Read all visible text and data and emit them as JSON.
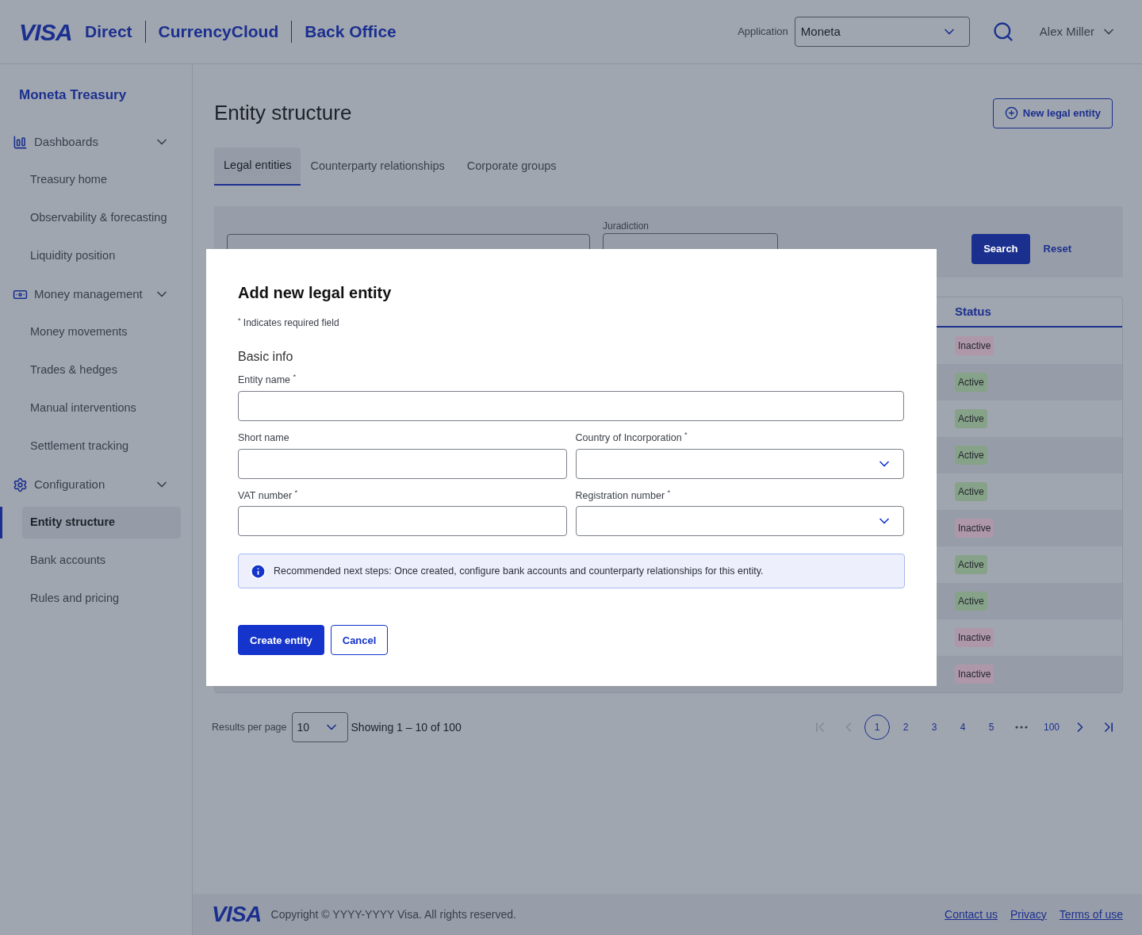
{
  "header": {
    "logo": "VISA",
    "products": [
      "Direct",
      "CurrencyCloud",
      "Back Office"
    ],
    "application": {
      "label": "Application",
      "value": "Moneta"
    },
    "user": "Alex Miller"
  },
  "sidebar": {
    "title": "Moneta Treasury",
    "groups": [
      {
        "label": "Dashboards",
        "expanded": true,
        "items": [
          {
            "label": "Treasury home",
            "selected": false
          },
          {
            "label": "Observability & forecasting",
            "selected": false
          },
          {
            "label": "Liquidity position",
            "selected": false
          }
        ]
      },
      {
        "label": "Money management",
        "expanded": true,
        "items": [
          {
            "label": "Money movements",
            "selected": false
          },
          {
            "label": "Trades & hedges",
            "selected": false
          },
          {
            "label": "Manual interventions",
            "selected": false
          },
          {
            "label": "Settlement tracking",
            "selected": false
          }
        ]
      },
      {
        "label": "Configuration",
        "expanded": true,
        "items": [
          {
            "label": "Entity structure",
            "selected": true
          },
          {
            "label": "Bank accounts",
            "selected": false
          },
          {
            "label": "Rules and pricing",
            "selected": false
          }
        ]
      }
    ]
  },
  "page": {
    "title": "Entity structure",
    "new_button": "New legal entity",
    "tabs": [
      {
        "label": "Legal entities",
        "selected": true
      },
      {
        "label": "Counterparty relationships",
        "selected": false
      },
      {
        "label": "Corporate groups",
        "selected": false
      }
    ],
    "filters": {
      "jurisdiction_label": "Juradiction",
      "search_button": "Search",
      "reset_button": "Reset"
    },
    "table": {
      "columns": [
        "Status"
      ],
      "rows": [
        {
          "status": "Inactive",
          "kind": "inactive"
        },
        {
          "status": "Active",
          "kind": "active"
        },
        {
          "status": "Active",
          "kind": "active"
        },
        {
          "status": "Active",
          "kind": "active"
        },
        {
          "status": "Active",
          "kind": "active"
        },
        {
          "status": "Inactive",
          "kind": "inactive"
        },
        {
          "status": "Active",
          "kind": "active"
        },
        {
          "status": "Active",
          "kind": "active"
        },
        {
          "status": "Inactive",
          "kind": "inactive"
        },
        {
          "status": "Inactive",
          "kind": "inactive"
        }
      ]
    },
    "pagination": {
      "results_label": "Results per page",
      "per_page": "10",
      "showing": "Showing 1 – 10 of 100",
      "back": [
        {
          "kind": "first",
          "disabled": true
        },
        {
          "kind": "prev",
          "disabled": true
        }
      ],
      "pages": [
        {
          "label": "1",
          "selected": true
        },
        {
          "label": "2",
          "selected": false
        },
        {
          "label": "3",
          "selected": false
        },
        {
          "label": "4",
          "selected": false
        },
        {
          "label": "5",
          "selected": false
        }
      ],
      "last_page": {
        "label": "100",
        "selected": false
      },
      "forward": [
        {
          "kind": "next",
          "disabled": false
        },
        {
          "kind": "last",
          "disabled": false
        }
      ]
    }
  },
  "footer": {
    "logo": "VISA",
    "copyright": "Copyright © YYYY-YYYY Visa. All rights reserved.",
    "links": [
      "Contact us",
      "Privacy",
      "Terms of use"
    ]
  },
  "modal": {
    "title": "Add new legal entity",
    "required_note": "$^{*}$ Indicates required field",
    "section": "Basic info",
    "fields": [
      {
        "label": "Entity name $^{*}$",
        "kind": "text",
        "wide": true
      },
      {
        "label": "Short name",
        "kind": "text",
        "wide": false
      },
      {
        "label": "Country of Incorporation $^{*}$",
        "kind": "select",
        "wide": false
      },
      {
        "label": "VAT number $^{*}$",
        "kind": "text",
        "wide": false
      },
      {
        "label": "Registration number $^{*}$",
        "kind": "select",
        "wide": false
      }
    ],
    "info": "Recommended next steps: Once created, configure bank accounts and counterparty relationships for this entity.",
    "primary_button": "Create entity",
    "secondary_button": "Cancel"
  }
}
